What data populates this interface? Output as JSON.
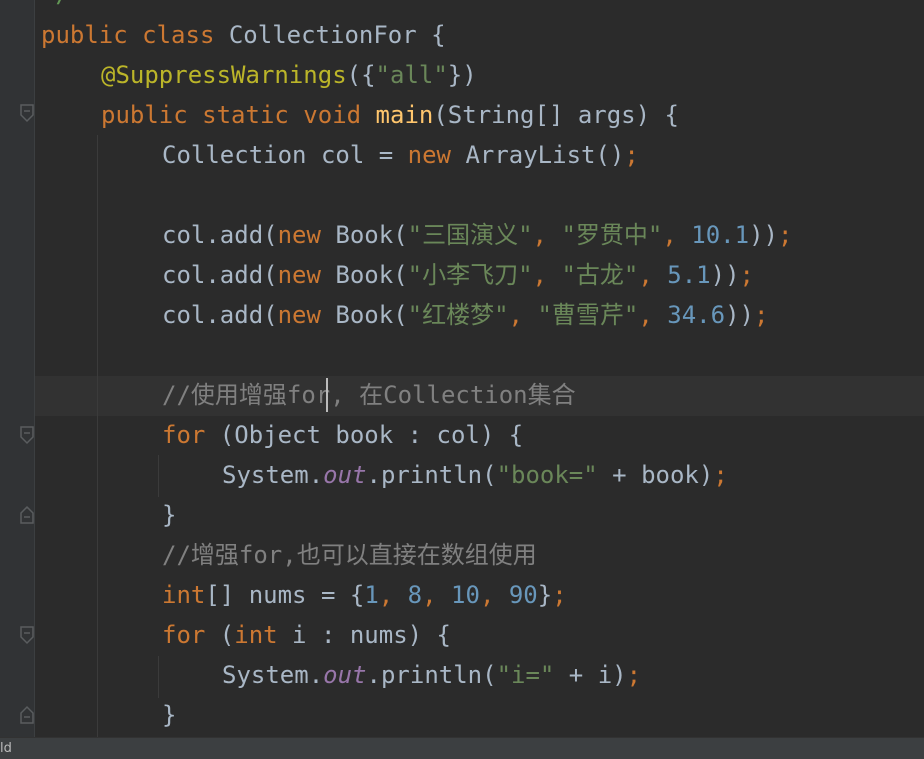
{
  "editor": {
    "top_partial": "*/",
    "lines": [
      {
        "tokens": [
          [
            "kw",
            "public class "
          ],
          [
            "pl",
            "CollectionFor {"
          ]
        ]
      },
      {
        "tokens": [
          [
            "ann",
            "@SuppressWarnings"
          ],
          [
            "pl",
            "({"
          ],
          [
            "str",
            "\"all\""
          ],
          [
            "pl",
            "})"
          ]
        ]
      },
      {
        "tokens": [
          [
            "kw",
            "public static void "
          ],
          [
            "fn",
            "main"
          ],
          [
            "pl",
            "(String[] args) {"
          ]
        ]
      },
      {
        "tokens": [
          [
            "pl",
            "Collection col = "
          ],
          [
            "kw",
            "new "
          ],
          [
            "pl",
            "ArrayList()"
          ],
          [
            "kw",
            ";"
          ]
        ]
      },
      {
        "tokens": []
      },
      {
        "tokens": [
          [
            "pl",
            "col.add("
          ],
          [
            "kw",
            "new "
          ],
          [
            "pl",
            "Book("
          ],
          [
            "str",
            "\"三国演义\""
          ],
          [
            "kw",
            ", "
          ],
          [
            "str",
            "\"罗贯中\""
          ],
          [
            "kw",
            ", "
          ],
          [
            "num",
            "10.1"
          ],
          [
            "pl",
            "))"
          ],
          [
            "kw",
            ";"
          ]
        ]
      },
      {
        "tokens": [
          [
            "pl",
            "col.add("
          ],
          [
            "kw",
            "new "
          ],
          [
            "pl",
            "Book("
          ],
          [
            "str",
            "\"小李飞刀\""
          ],
          [
            "kw",
            ", "
          ],
          [
            "str",
            "\"古龙\""
          ],
          [
            "kw",
            ", "
          ],
          [
            "num",
            "5.1"
          ],
          [
            "pl",
            "))"
          ],
          [
            "kw",
            ";"
          ]
        ]
      },
      {
        "tokens": [
          [
            "pl",
            "col.add("
          ],
          [
            "kw",
            "new "
          ],
          [
            "pl",
            "Book("
          ],
          [
            "str",
            "\"红楼梦\""
          ],
          [
            "kw",
            ", "
          ],
          [
            "str",
            "\"曹雪芹\""
          ],
          [
            "kw",
            ", "
          ],
          [
            "num",
            "34.6"
          ],
          [
            "pl",
            "))"
          ],
          [
            "kw",
            ";"
          ]
        ]
      },
      {
        "tokens": []
      },
      {
        "tokens": [
          [
            "cmt",
            "//使用增强for, 在Collection集合"
          ]
        ]
      },
      {
        "tokens": [
          [
            "kw",
            "for "
          ],
          [
            "pl",
            "(Object book : col) {"
          ]
        ]
      },
      {
        "tokens": [
          [
            "pl",
            "System."
          ],
          [
            "fld",
            "out"
          ],
          [
            "pl",
            ".println("
          ],
          [
            "str",
            "\"book=\""
          ],
          [
            "pl",
            " + book)"
          ],
          [
            "kw",
            ";"
          ]
        ]
      },
      {
        "tokens": [
          [
            "pl",
            "}"
          ]
        ]
      },
      {
        "tokens": [
          [
            "cmt",
            "//增强for,也可以直接在数组使用"
          ]
        ]
      },
      {
        "tokens": [
          [
            "kw",
            "int"
          ],
          [
            "pl",
            "[] nums = {"
          ],
          [
            "num",
            "1"
          ],
          [
            "kw",
            ", "
          ],
          [
            "num",
            "8"
          ],
          [
            "kw",
            ", "
          ],
          [
            "num",
            "10"
          ],
          [
            "kw",
            ", "
          ],
          [
            "num",
            "90"
          ],
          [
            "pl",
            "}"
          ],
          [
            "kw",
            ";"
          ]
        ]
      },
      {
        "tokens": [
          [
            "kw",
            "for "
          ],
          [
            "pl",
            "("
          ],
          [
            "kw",
            "int "
          ],
          [
            "pl",
            "i : nums) {"
          ]
        ]
      },
      {
        "tokens": [
          [
            "pl",
            "System."
          ],
          [
            "fld",
            "out"
          ],
          [
            "pl",
            ".println("
          ],
          [
            "str",
            "\"i=\""
          ],
          [
            "pl",
            " + i)"
          ],
          [
            "kw",
            ";"
          ]
        ]
      },
      {
        "tokens": [
          [
            "pl",
            "}"
          ]
        ]
      }
    ]
  },
  "status_bar": {
    "text": "ld"
  }
}
